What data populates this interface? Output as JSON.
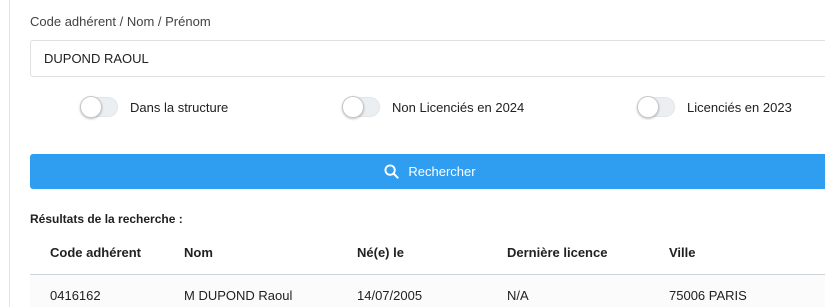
{
  "search": {
    "label": "Code adhérent / Nom / Prénom",
    "value": "DUPOND RAOUL"
  },
  "filters": [
    {
      "label": "Dans la structure",
      "checked": false
    },
    {
      "label": "Non Licenciés en 2024",
      "checked": false
    },
    {
      "label": "Licenciés en 2023",
      "checked": false
    }
  ],
  "search_button": {
    "label": "Rechercher",
    "icon": "search-icon",
    "color": "#2f9ef0"
  },
  "results": {
    "title": "Résultats de la recherche :",
    "columns": [
      "Code adhérent",
      "Nom",
      "Né(e) le",
      "Dernière licence",
      "Ville"
    ],
    "rows": [
      [
        "0416162",
        "M DUPOND Raoul",
        "14/07/2005",
        "N/A",
        "75006 PARIS"
      ]
    ]
  }
}
